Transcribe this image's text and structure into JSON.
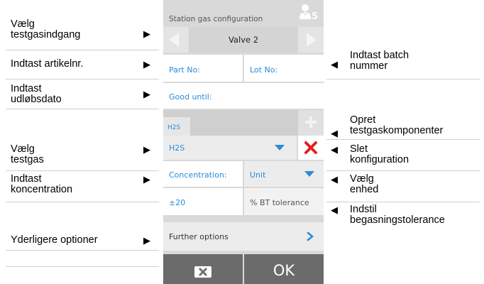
{
  "annotations": {
    "select_gas_inlet": "Vælg\ntestgasindgang",
    "enter_article_no": "Indtast artikelnr.",
    "enter_expiry_date": "Indtast\nudløbsdato",
    "select_test_gas": "Vælg\ntestgas",
    "enter_concentration": "Indtast\nkoncentration",
    "further_options": "Yderligere optioner",
    "enter_batch_number": "Indtast batch\nnummer",
    "create_test_gas_components": "Opret\ntestgaskomponenter",
    "delete_configuration": "Slet\nkonfiguration",
    "select_unit": "Vælg\nenhed",
    "set_gassing_tolerance": "Indstil\nbegasningstolerance",
    "arrow_right": "▶",
    "arrow_left": "◀"
  },
  "device": {
    "title": "Station gas configuration",
    "user_badge": "5",
    "valve_label": "Valve 2",
    "part_no_label": "Part No:",
    "lot_no_label": "Lot No:",
    "good_until_label": "Good until:",
    "component_tab_label": "H2S",
    "gas_select_value": "H2S",
    "concentration_label": "Concentration:",
    "unit_select_value": "Unit",
    "tolerance_value": "±20",
    "tolerance_unit_label": "% BT tolerance",
    "further_options_label": "Further options",
    "ok_label": "OK"
  },
  "colors": {
    "accent_blue": "#2a8bd8",
    "delete_red": "#e02020",
    "footer_gray": "#6b6b6b",
    "panel_bg": "#d9d9d9"
  }
}
